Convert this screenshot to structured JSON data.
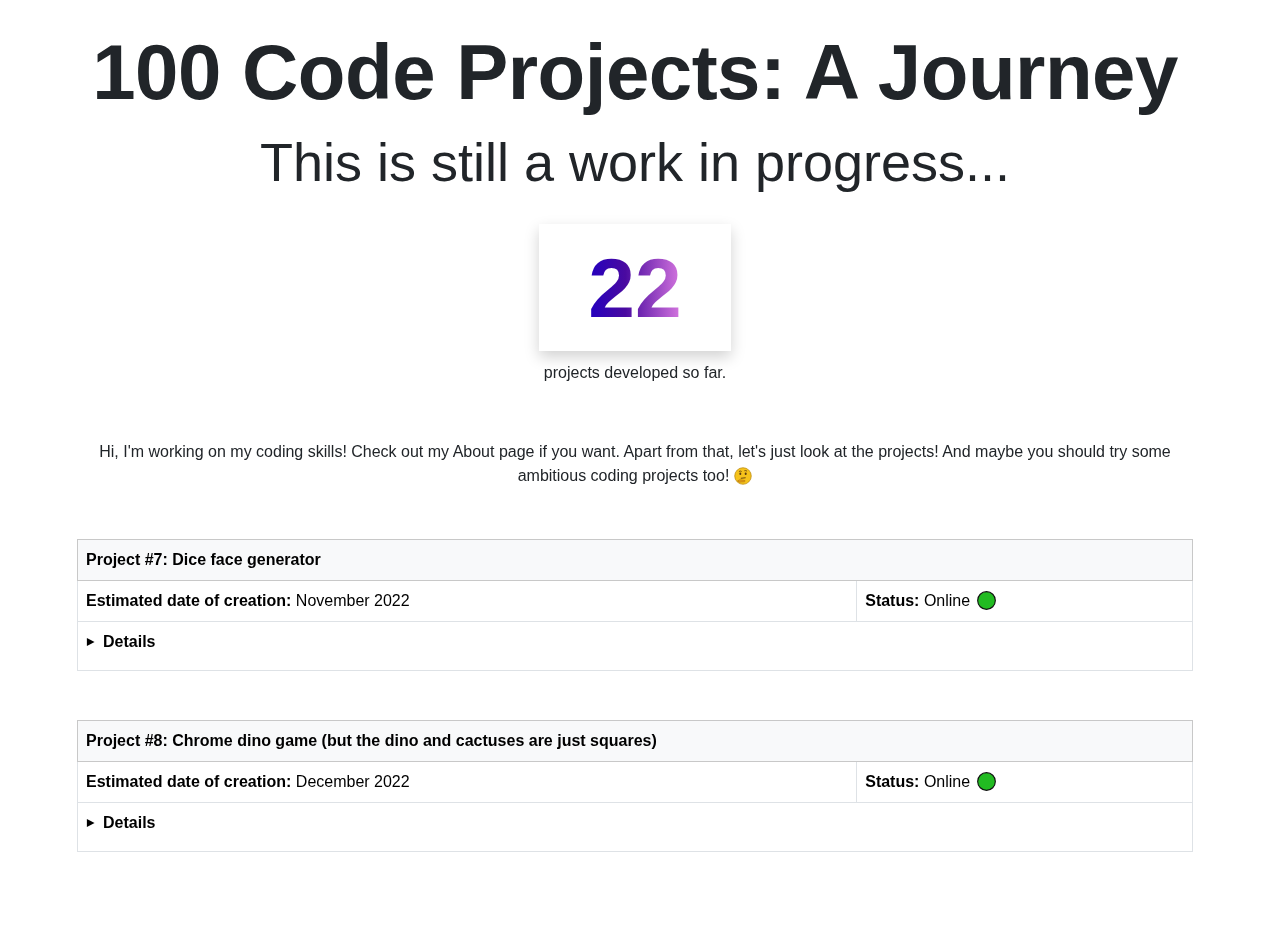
{
  "header": {
    "title": "100 Code Projects: A Journey",
    "subtitle": "This is still a work in progress..."
  },
  "counter": {
    "value": "22",
    "caption": "projects developed so far."
  },
  "intro": {
    "lines": [
      "Hi, I'm working on my coding skills! Check out my About page if you want. Apart from that, let's just look at the projects! And maybe you should try some",
      "ambitious coding projects too!"
    ]
  },
  "projects": [
    {
      "title": "Project #7: Dice face generator",
      "date": "**Estimated date of creation:** November 2022",
      "status": "**Status:** Online",
      "color": "#22bb22",
      "details_label": "Details",
      "expanded": false
    },
    {
      "title": "Project #8: Chrome dino game (but the dino and cactuses are just squares)",
      "date": "**Estimated date of creation:** December 2022",
      "status": "**Status:** Online",
      "color": "#22bb22",
      "details_label": "Details",
      "expanded": false
    }
  ]
}
